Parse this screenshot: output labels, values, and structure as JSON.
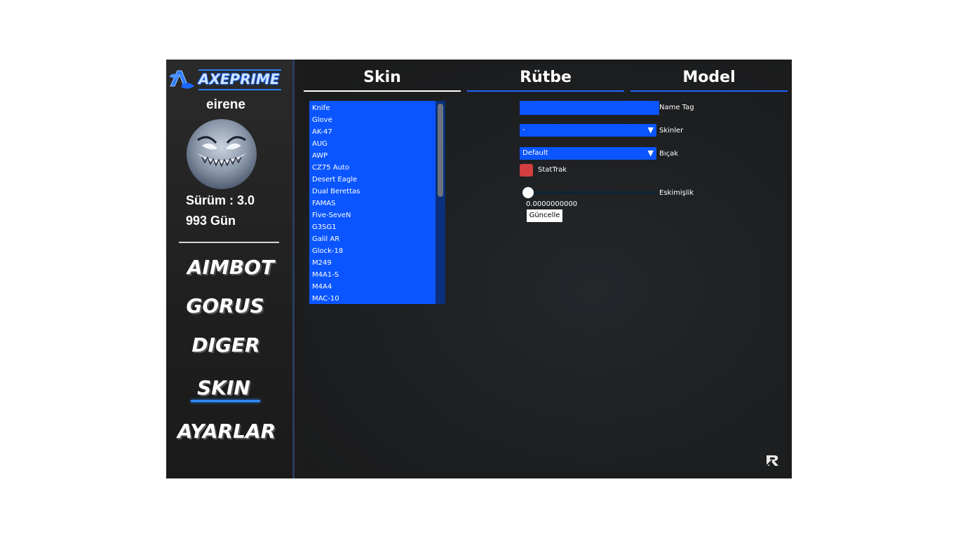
{
  "app": {
    "brand": "AXEPRIME",
    "username": "eirene",
    "version": "Sürüm : 3.0",
    "days": "993 Gün"
  },
  "nav": {
    "items": [
      "AIMBOT",
      "GORUS",
      "DIGER",
      "SKIN",
      "AYARLAR"
    ],
    "active": "SKIN"
  },
  "tabs": [
    "Skin",
    "Rütbe",
    "Model"
  ],
  "active_tab": "Skin",
  "weapons": [
    "Knife",
    "Glove",
    "AK-47",
    "AUG",
    "AWP",
    "CZ75 Auto",
    "Desert Eagle",
    "Dual Berettas",
    "FAMAS",
    "Five-SeveN",
    "G3SG1",
    "Galil AR",
    "Glock-18",
    "M249",
    "M4A1-S",
    "M4A4",
    "MAC-10"
  ],
  "controls": {
    "name_tag": {
      "label": "Name Tag",
      "value": ""
    },
    "skins": {
      "label": "Skinler",
      "selected": "-"
    },
    "knife": {
      "label": "Bıçak",
      "selected": "Default"
    },
    "stattrak": {
      "label": "StatTrak",
      "checked": false
    },
    "wear": {
      "label": "Eskimişlik",
      "value": "0.0000000000",
      "fraction": 0.0
    },
    "update_label": "Güncelle"
  },
  "colors": {
    "accent": "#0a55ff",
    "stattrak": "#d33f40",
    "highlight": "#2f8bff"
  },
  "icons": {
    "logo": "axe-logo-icon",
    "corner": "r-logo-icon",
    "dropdown": "triangle-down-icon"
  }
}
